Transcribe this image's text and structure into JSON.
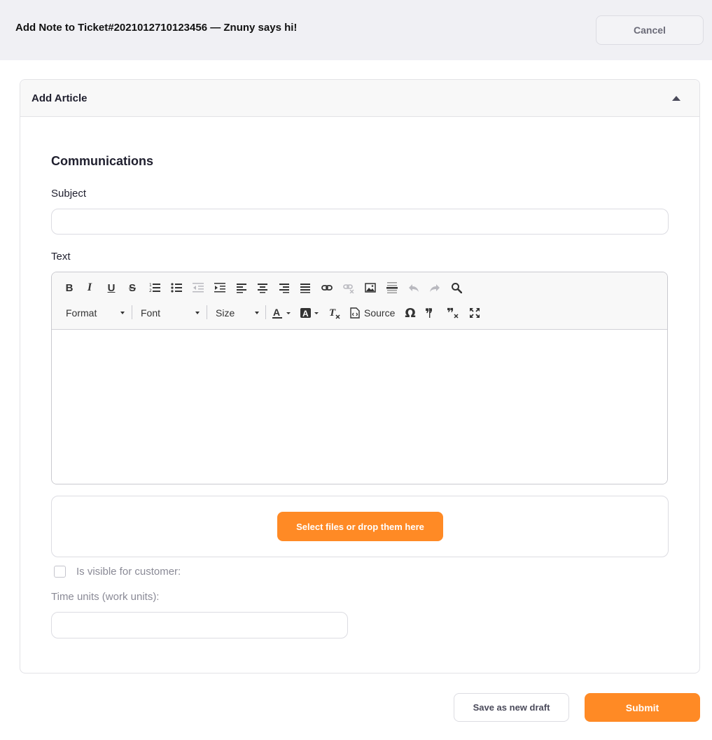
{
  "header": {
    "title": "Add Note to Ticket#2021012710123456 — Znuny says hi!",
    "cancel_label": "Cancel"
  },
  "widget": {
    "title": "Add Article"
  },
  "form": {
    "section_title": "Communications",
    "subject_label": "Subject",
    "subject_value": "",
    "text_label": "Text",
    "editor": {
      "format_label": "Format",
      "font_label": "Font",
      "size_label": "Size",
      "source_label": "Source"
    },
    "upload_label": "Select files or drop them here",
    "visible_label": "Is visible for customer:",
    "visible_checked": false,
    "time_units_label": "Time units (work units):",
    "time_units_value": ""
  },
  "footer": {
    "draft_label": "Save as new draft",
    "submit_label": "Submit"
  },
  "colors": {
    "accent": "#ff8a25",
    "header_bg": "#f0f0f4"
  }
}
